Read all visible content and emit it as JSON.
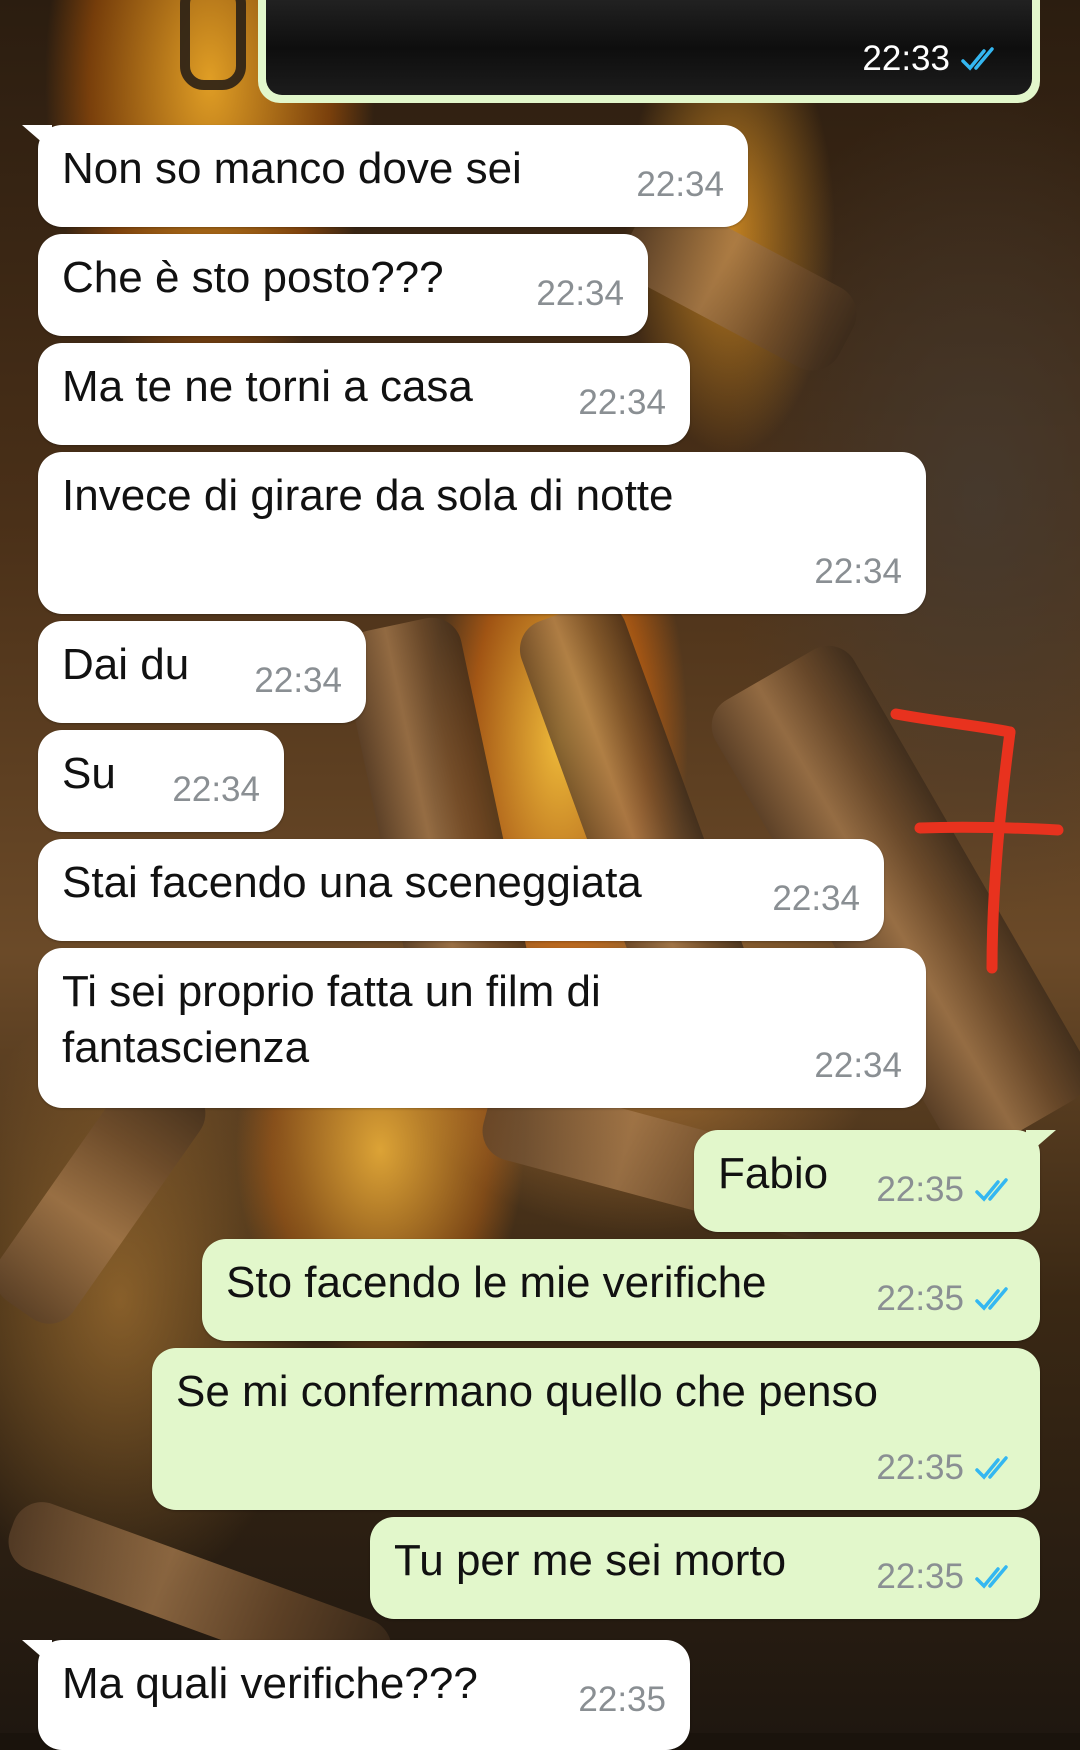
{
  "chat": {
    "image_message": {
      "time": "22:33",
      "status": "read"
    },
    "messages": [
      {
        "direction": "incoming",
        "text": "Non so manco dove sei",
        "time": "22:34"
      },
      {
        "direction": "incoming",
        "text": "Che è sto posto???",
        "time": "22:34"
      },
      {
        "direction": "incoming",
        "text": "Ma te ne torni a casa",
        "time": "22:34"
      },
      {
        "direction": "incoming",
        "text": "Invece di girare da sola di notte",
        "time": "22:34"
      },
      {
        "direction": "incoming",
        "text": "Dai du",
        "time": "22:34"
      },
      {
        "direction": "incoming",
        "text": "Su",
        "time": "22:34"
      },
      {
        "direction": "incoming",
        "text": "Stai facendo una sceneggiata",
        "time": "22:34"
      },
      {
        "direction": "incoming",
        "text": "Ti sei proprio fatta un film di fantascienza",
        "time": "22:34"
      },
      {
        "direction": "outgoing",
        "text": "Fabio",
        "time": "22:35",
        "status": "read"
      },
      {
        "direction": "outgoing",
        "text": "Sto facendo le mie verifiche",
        "time": "22:35",
        "status": "read"
      },
      {
        "direction": "outgoing",
        "text": "Se mi confermano quello che penso",
        "time": "22:35",
        "status": "read"
      },
      {
        "direction": "outgoing",
        "text": "Tu per me sei morto",
        "time": "22:35",
        "status": "read"
      },
      {
        "direction": "incoming",
        "text": "Ma quali verifiche???",
        "time": "22:35"
      }
    ]
  },
  "colors": {
    "incoming_bubble": "#ffffff",
    "outgoing_bubble": "#e2f7cb",
    "read_ticks": "#34b7f1",
    "timestamp": "#8a8f93",
    "annotation": "#e8321e"
  },
  "icons": {
    "read_receipt": "double-check-icon"
  }
}
